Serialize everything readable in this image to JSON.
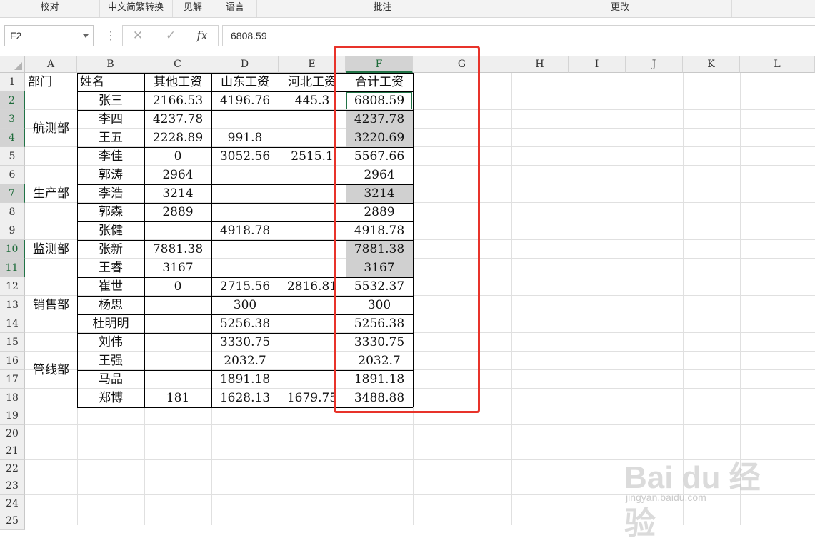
{
  "ribbon": {
    "groups": [
      "校对",
      "中文简繁转换",
      "见解",
      "语言",
      "批注",
      "更改"
    ]
  },
  "formula_bar": {
    "name_box": "F2",
    "cancel_icon": "✕",
    "enter_icon": "✓",
    "fx_label": "fx",
    "value": "6808.59"
  },
  "columns": [
    "A",
    "B",
    "C",
    "D",
    "E",
    "F",
    "G",
    "H",
    "I",
    "J",
    "K",
    "L"
  ],
  "rows": [
    "1",
    "2",
    "3",
    "4",
    "5",
    "6",
    "7",
    "8",
    "9",
    "10",
    "11",
    "12",
    "13",
    "14",
    "15",
    "16",
    "17",
    "18",
    "19",
    "20",
    "21",
    "22",
    "23",
    "24",
    "25"
  ],
  "headers": [
    "部门",
    "姓名",
    "其他工资",
    "山东工资",
    "河北工资",
    "合计工资"
  ],
  "departments": [
    "航测部",
    "生产部",
    "监测部",
    "销售部",
    "管线部"
  ],
  "table": [
    {
      "name": "张三",
      "other": "2166.53",
      "sd": "4196.76",
      "hb": "445.3",
      "total": "6808.59"
    },
    {
      "name": "李四",
      "other": "4237.78",
      "sd": "",
      "hb": "",
      "total": "4237.78"
    },
    {
      "name": "王五",
      "other": "2228.89",
      "sd": "991.8",
      "hb": "",
      "total": "3220.69"
    },
    {
      "name": "李佳",
      "other": "0",
      "sd": "3052.56",
      "hb": "2515.1",
      "total": "5567.66"
    },
    {
      "name": "郭涛",
      "other": "2964",
      "sd": "",
      "hb": "",
      "total": "2964"
    },
    {
      "name": "李浩",
      "other": "3214",
      "sd": "",
      "hb": "",
      "total": "3214"
    },
    {
      "name": "郭森",
      "other": "2889",
      "sd": "",
      "hb": "",
      "total": "2889"
    },
    {
      "name": "张健",
      "other": "",
      "sd": "4918.78",
      "hb": "",
      "total": "4918.78"
    },
    {
      "name": "张新",
      "other": "7881.38",
      "sd": "",
      "hb": "",
      "total": "7881.38"
    },
    {
      "name": "王睿",
      "other": "3167",
      "sd": "",
      "hb": "",
      "total": "3167"
    },
    {
      "name": "崔世",
      "other": "0",
      "sd": "2715.56",
      "hb": "2816.81",
      "total": "5532.37"
    },
    {
      "name": "杨思",
      "other": "",
      "sd": "300",
      "hb": "",
      "total": "300"
    },
    {
      "name": "杜明明",
      "other": "",
      "sd": "5256.38",
      "hb": "",
      "total": "5256.38"
    },
    {
      "name": "刘伟",
      "other": "",
      "sd": "3330.75",
      "hb": "",
      "total": "3330.75"
    },
    {
      "name": "王强",
      "other": "",
      "sd": "2032.7",
      "hb": "",
      "total": "2032.7"
    },
    {
      "name": "马品",
      "other": "",
      "sd": "1891.18",
      "hb": "",
      "total": "1891.18"
    },
    {
      "name": "郑博",
      "other": "181",
      "sd": "1628.13",
      "hb": "1679.75",
      "total": "3488.88"
    }
  ],
  "watermark": {
    "brand": "Bai du 经验",
    "url": "jingyan.baidu.com"
  }
}
